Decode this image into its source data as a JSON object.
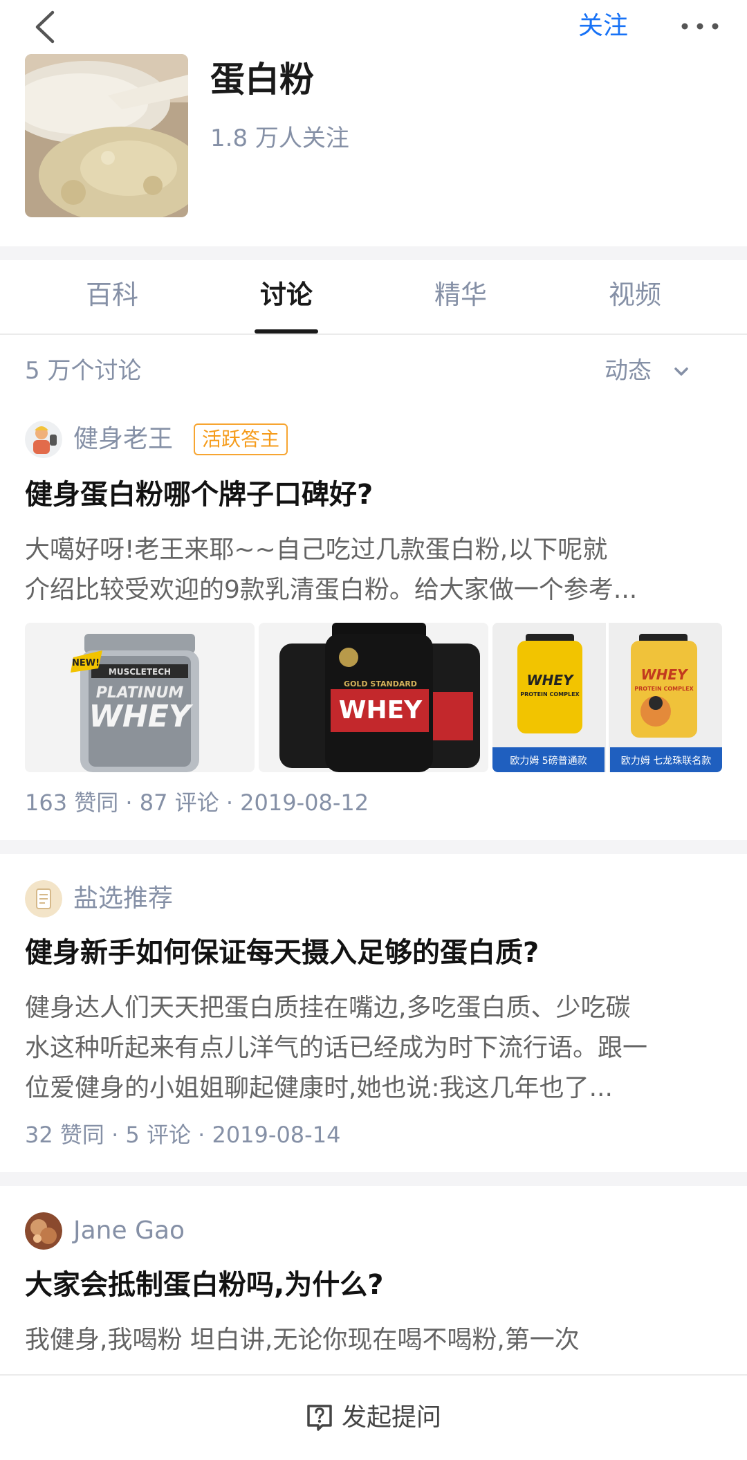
{
  "nav": {
    "follow_label": "关注"
  },
  "topic": {
    "title": "蛋白粉",
    "followers": "1.8 万人关注"
  },
  "tabs": [
    "百科",
    "讨论",
    "精华",
    "视频"
  ],
  "discussion": {
    "count_label": "5 万个讨论",
    "sort_label": "动态"
  },
  "cards": [
    {
      "author": "健身老王",
      "badge": "活跃答主",
      "title": "健身蛋白粉哪个牌子口碑好?",
      "excerpt_lines": [
        "大噶好呀!老王来耶~~自己吃过几款蛋白粉,以下呢就",
        "介绍比较受欢迎的9款乳清蛋白粉。给大家做一个参考..."
      ],
      "images": [
        {
          "brand": "MUSCLETECH",
          "line1": "PLATINUM",
          "line2": "WHEY",
          "tag": "NEW!"
        },
        {
          "brand": "ON",
          "line1": "GOLD STANDARD",
          "line2": "WHEY"
        },
        {
          "line1": "WHEY",
          "line2": "PROTEIN COMPLEX",
          "caption": "欧力姆 5磅普通款"
        },
        {
          "line1": "WHEY",
          "line2": "PROTEIN COMPLEX",
          "caption": "欧力姆 七龙珠联名款"
        }
      ],
      "meta": "163 赞同 · 87 评论 · 2019-08-12"
    },
    {
      "author": "盐选推荐",
      "title": "健身新手如何保证每天摄入足够的蛋白质?",
      "excerpt_lines": [
        "健身达人们天天把蛋白质挂在嘴边,多吃蛋白质、少吃碳",
        "水这种听起来有点儿洋气的话已经成为时下流行语。跟一",
        "位爱健身的小姐姐聊起健康时,她也说:我这几年也了..."
      ],
      "meta": "32 赞同 · 5 评论 · 2019-08-14"
    },
    {
      "author": "Jane Gao",
      "title": "大家会抵制蛋白粉吗,为什么?",
      "excerpt_lines": [
        "我健身,我喝粉 坦白讲,无论你现在喝不喝粉,第一次"
      ]
    }
  ],
  "bottom": {
    "ask_label": "发起提问"
  },
  "colors": {
    "accent": "#1772f6",
    "badge": "#f59b1a",
    "muted": "#8590a6"
  }
}
